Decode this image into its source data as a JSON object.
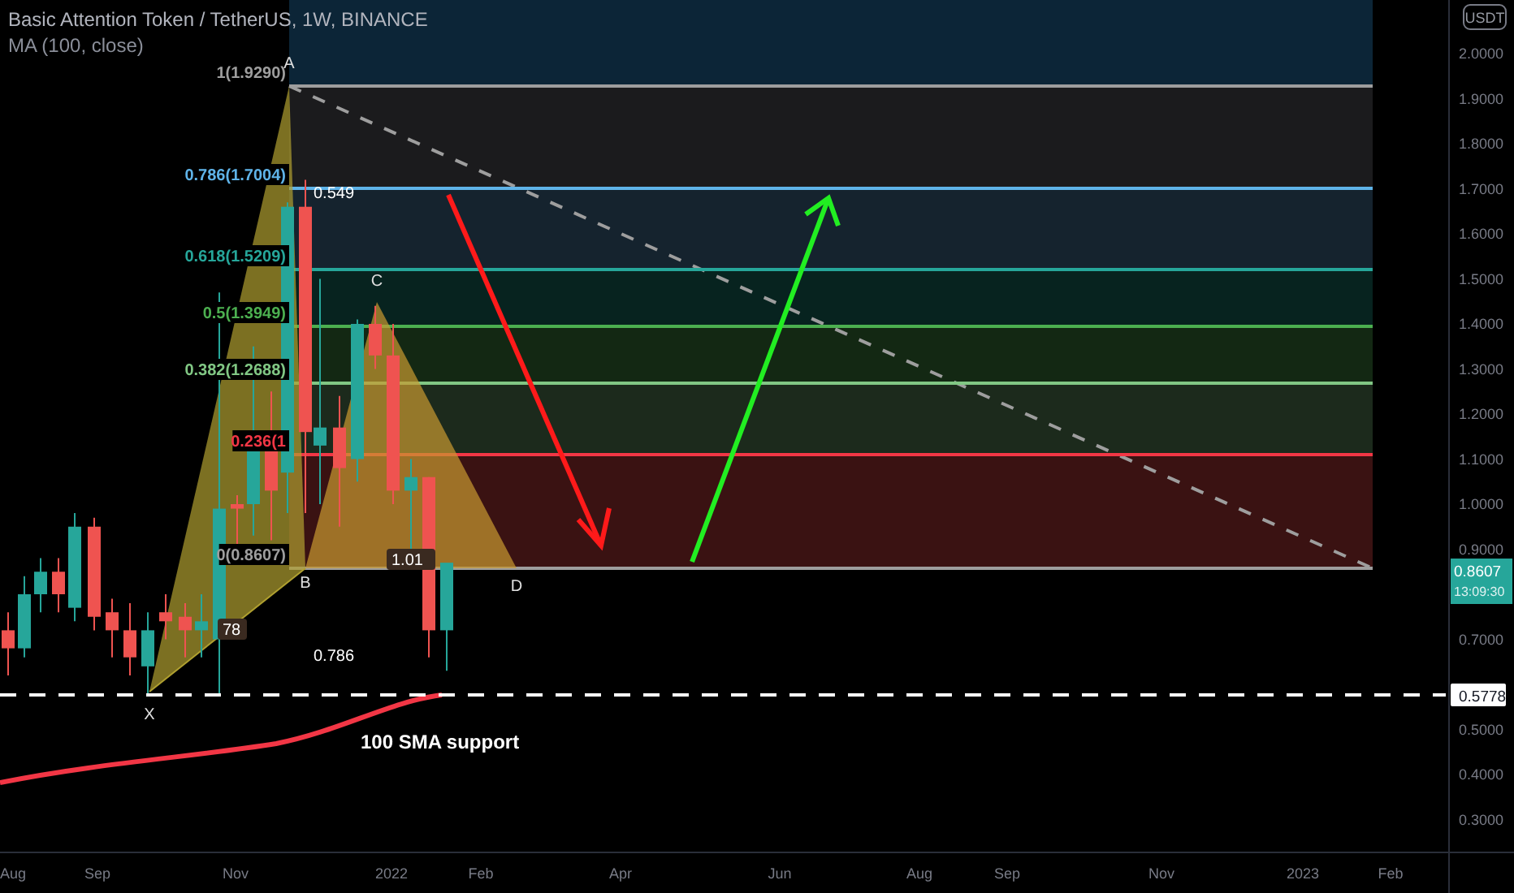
{
  "header": {
    "title": "Basic Attention Token / TetherUS, 1W, BINANCE",
    "indicator": "MA (100, close)"
  },
  "fib_levels": [
    {
      "label": "1(1.9290)",
      "color": "#9e9e9e"
    },
    {
      "label": "0.786(1.7004)",
      "color": "#5fb3e8"
    },
    {
      "label": "0.618(1.5209)",
      "color": "#26a69a"
    },
    {
      "label": "0.5(1.3949)",
      "color": "#4caf50"
    },
    {
      "label": "0.382(1.2688)",
      "color": "#81c784"
    },
    {
      "label": "0.236(1",
      "color": "#f23645"
    },
    {
      "label": "0(0.8607)",
      "color": "#9e9e9e"
    }
  ],
  "pattern_points": [
    "X",
    "A",
    "B",
    "C",
    "D"
  ],
  "ratio_labels": [
    "0.549",
    "78",
    "0.786",
    "1.01"
  ],
  "annotation": "100 SMA support",
  "price_axis": {
    "currency": "USDT",
    "ticks": [
      "2.0000",
      "1.9000",
      "1.8000",
      "1.7000",
      "1.6000",
      "1.5000",
      "1.4000",
      "1.3000",
      "1.2000",
      "1.1000",
      "1.0000",
      "0.9000",
      "0.7000",
      "0.5000",
      "0.4000",
      "0.3000"
    ],
    "last_price": "0.8607",
    "countdown": "13:09:30",
    "line_price": "0.5778"
  },
  "time_axis": [
    "Aug",
    "Sep",
    "Nov",
    "2022",
    "Feb",
    "Apr",
    "Jun",
    "Aug",
    "Sep",
    "Nov",
    "2023",
    "Feb"
  ]
}
